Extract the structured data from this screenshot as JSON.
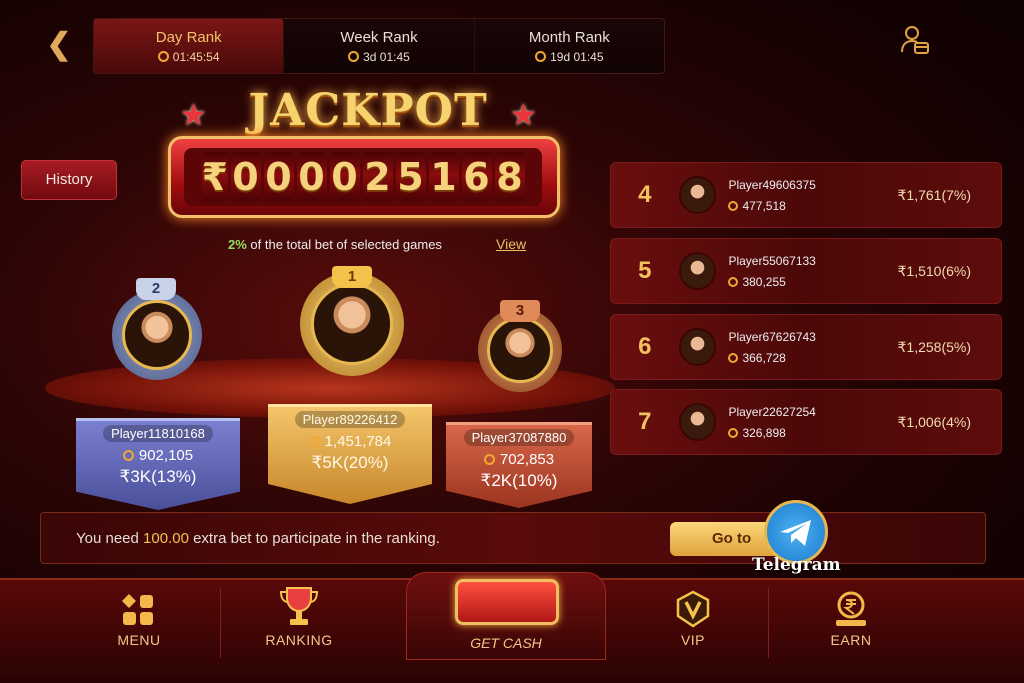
{
  "header": {
    "back_icon": "chevron-left-icon",
    "tabs": [
      {
        "label": "Day Rank",
        "timer": "01:45:54",
        "active": true
      },
      {
        "label": "Week Rank",
        "timer": "3d 01:45",
        "active": false
      },
      {
        "label": "Month Rank",
        "timer": "19d 01:45",
        "active": false
      }
    ],
    "profile_icon": "user-wallet-icon"
  },
  "jackpot": {
    "title": "JACKPOT",
    "currency": "₹",
    "digits": [
      "0",
      "0",
      "0",
      "0",
      "2",
      "5",
      "1",
      "6",
      "8"
    ],
    "percent": "2%",
    "description": "of the total bet of selected games",
    "view_label": "View"
  },
  "history_label": "History",
  "podium": [
    {
      "rank": "2",
      "player": "Player11810168",
      "score": "902,105",
      "prize": "₹3K(13%)"
    },
    {
      "rank": "1",
      "player": "Player89226412",
      "score": "1,451,784",
      "prize": "₹5K(20%)"
    },
    {
      "rank": "3",
      "player": "Player37087880",
      "score": "702,853",
      "prize": "₹2K(10%)"
    }
  ],
  "ranking_list": [
    {
      "rank": "4",
      "player": "Player49606375",
      "score": "477,518",
      "prize": "₹1,761(7%)"
    },
    {
      "rank": "5",
      "player": "Player55067133",
      "score": "380,255",
      "prize": "₹1,510(6%)"
    },
    {
      "rank": "6",
      "player": "Player67626743",
      "score": "366,728",
      "prize": "₹1,258(5%)"
    },
    {
      "rank": "7",
      "player": "Player22627254",
      "score": "326,898",
      "prize": "₹1,006(4%)"
    }
  ],
  "notice": {
    "prefix": "You need",
    "amount": "100.00",
    "suffix": "extra bet to participate in the ranking.",
    "goto_label": "Go to",
    "telegram_label": "Telegram"
  },
  "nav": {
    "menu": "MENU",
    "ranking": "RANKING",
    "get_cash": "GET CASH",
    "vip": "VIP",
    "earn": "EARN"
  },
  "colors": {
    "gold": "#f4c26a",
    "background": "#2c0505",
    "rank2_card": "#5a5fb0",
    "rank1_card": "#e0a33a",
    "rank3_card": "#b8452c",
    "highlight_green": "#8fe060"
  }
}
